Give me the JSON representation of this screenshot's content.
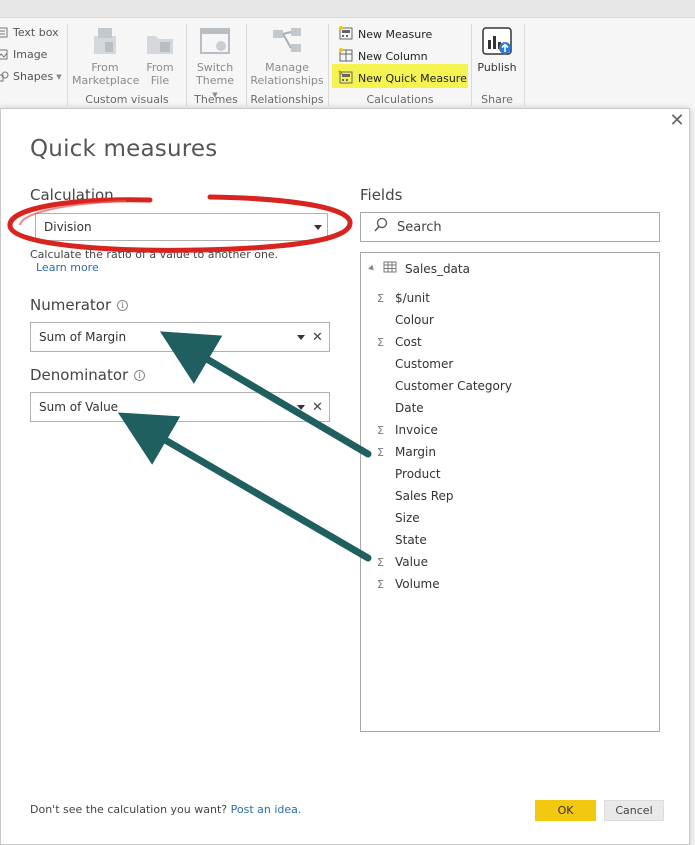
{
  "ribbon": {
    "small_items": [
      "Text box",
      "Image",
      "Shapes"
    ],
    "custom_visuals": {
      "from_marketplace": [
        "From",
        "Marketplace"
      ],
      "from_file": [
        "From",
        "File"
      ],
      "group_label": "Custom visuals"
    },
    "themes": {
      "switch_theme": [
        "Switch",
        "Theme"
      ],
      "group_label": "Themes"
    },
    "relationships": {
      "manage": [
        "Manage",
        "Relationships"
      ],
      "group_label": "Relationships"
    },
    "calculations": {
      "new_measure": "New Measure",
      "new_column": "New Column",
      "new_quick_measure": "New Quick Measure",
      "group_label": "Calculations"
    },
    "share": {
      "publish": "Publish",
      "group_label": "Share"
    }
  },
  "dialog": {
    "title": "Quick measures",
    "close_glyph": "✕",
    "calculation_label": "Calculation",
    "calculation_value": "Division",
    "calculation_description": "Calculate the ratio of a value to another one.",
    "learn_more": "Learn more",
    "numerator_label": "Numerator",
    "numerator_value": "Sum of Margin",
    "denominator_label": "Denominator",
    "denominator_value": "Sum of Value",
    "fields_label": "Fields",
    "search_placeholder": "Search",
    "table_name": "Sales_data",
    "fields": [
      {
        "name": "$/unit",
        "sigma": true
      },
      {
        "name": "Colour",
        "sigma": false
      },
      {
        "name": "Cost",
        "sigma": true
      },
      {
        "name": "Customer",
        "sigma": false
      },
      {
        "name": "Customer Category",
        "sigma": false
      },
      {
        "name": "Date",
        "sigma": false
      },
      {
        "name": "Invoice",
        "sigma": true
      },
      {
        "name": "Margin",
        "sigma": true
      },
      {
        "name": "Product",
        "sigma": false
      },
      {
        "name": "Sales Rep",
        "sigma": false
      },
      {
        "name": "Size",
        "sigma": false
      },
      {
        "name": "State",
        "sigma": false
      },
      {
        "name": "Value",
        "sigma": true
      },
      {
        "name": "Volume",
        "sigma": true
      }
    ],
    "footer_text": "Don't see the calculation you want?",
    "footer_link": "Post an idea.",
    "ok_label": "OK",
    "cancel_label": "Cancel"
  },
  "colors": {
    "highlight": "#f4f34f",
    "annotation_circle": "#d9231f",
    "annotation_arrow": "#1f5f5f",
    "ok_button": "#f2c811"
  }
}
